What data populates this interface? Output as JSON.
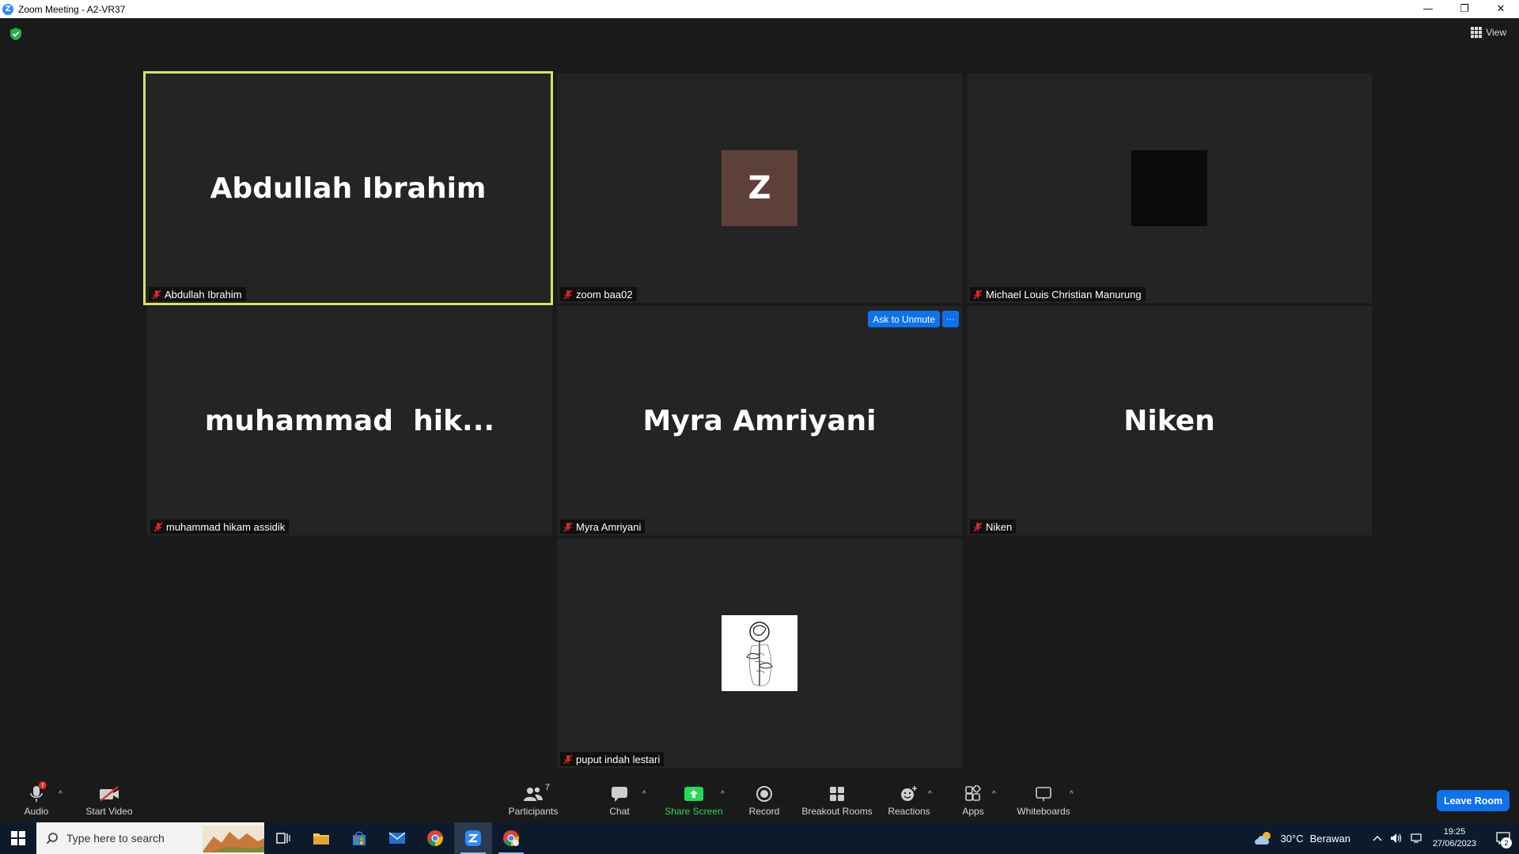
{
  "window": {
    "title": "Zoom Meeting - A2-VR37",
    "logo_letter": "Z",
    "minimize": "—",
    "restore": "❐",
    "close": "✕"
  },
  "top_controls": {
    "view_label": "View"
  },
  "tiles": [
    {
      "big_name": "Abdullah Ibrahim",
      "label": "Abdullah Ibrahim",
      "muted": true,
      "active_speaker": true
    },
    {
      "avatar_letter": "Z",
      "label": "zoom baa02",
      "muted": true
    },
    {
      "label": "Michael Louis Christian Manurung",
      "muted": true
    },
    {
      "big_name": "muhammad  hik...",
      "label": "muhammad hikam assidik",
      "muted": true
    },
    {
      "big_name": "Myra Amriyani",
      "label": "Myra Amriyani",
      "muted": true,
      "ask_unmute_label": "Ask to Unmute",
      "more_label": "···"
    },
    {
      "big_name": "Niken",
      "label": "Niken",
      "muted": true
    },
    {
      "label": "puput indah lestari",
      "muted": true
    }
  ],
  "toolbar": {
    "audio_label": "Audio",
    "audio_badge": "!",
    "start_video_label": "Start Video",
    "participants_label": "Participants",
    "participants_count": "7",
    "chat_label": "Chat",
    "share_screen_label": "Share Screen",
    "record_label": "Record",
    "breakout_label": "Breakout Rooms",
    "reactions_label": "Reactions",
    "apps_label": "Apps",
    "whiteboards_label": "Whiteboards",
    "leave_label": "Leave Room",
    "caret": "^"
  },
  "taskbar": {
    "search_placeholder": "Type here to search",
    "weather_temp": "30°C",
    "weather_desc": "Berawan",
    "time": "19:25",
    "date": "27/06/2023",
    "notification_count": "2"
  },
  "colors": {
    "active_border": "#d8e55a",
    "accent_blue": "#0e72ed",
    "share_green": "#23d959",
    "mute_red": "#e02828"
  }
}
